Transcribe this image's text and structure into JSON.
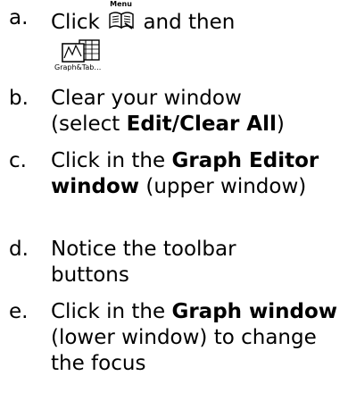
{
  "steps": [
    {
      "marker": "a.",
      "text_before": "Click",
      "menu_icon_caption": "Menu",
      "text_after": "and then",
      "graph_icon_caption": "Graph&Tab…",
      "icons": [
        "menu-book-icon",
        "graph-table-icon"
      ]
    },
    {
      "marker": "b.",
      "line1": "Clear your window",
      "line2_prefix": "(select ",
      "line2_bold": "Edit/Clear All",
      "line2_suffix": ")"
    },
    {
      "marker": "c.",
      "prefix": "Click in the ",
      "bold": "Graph Editor window",
      "suffix": " (upper window)"
    },
    {
      "marker": "d.",
      "line1": "Notice the toolbar",
      "line2": "buttons"
    },
    {
      "marker": "e.",
      "prefix": "Click in the ",
      "bold": "Graph window",
      "suffix": " (lower window) to  change the focus"
    }
  ]
}
